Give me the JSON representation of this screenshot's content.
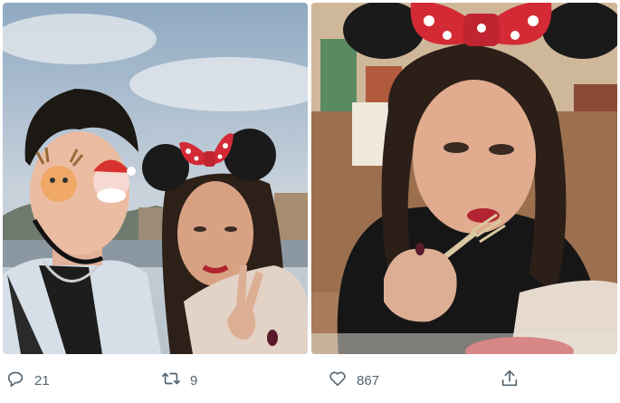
{
  "media": {
    "photos": [
      {
        "name": "couple-selfie-photo"
      },
      {
        "name": "woman-eating-photo"
      }
    ]
  },
  "actions": {
    "reply_count": "21",
    "retweet_count": "9",
    "like_count": "867",
    "icons": [
      "reply-icon",
      "retweet-icon",
      "like-icon",
      "share-icon"
    ]
  },
  "colors": {
    "action_gray": "#536471",
    "bow_red": "#d42a35",
    "ears_black": "#1a1a1a"
  }
}
